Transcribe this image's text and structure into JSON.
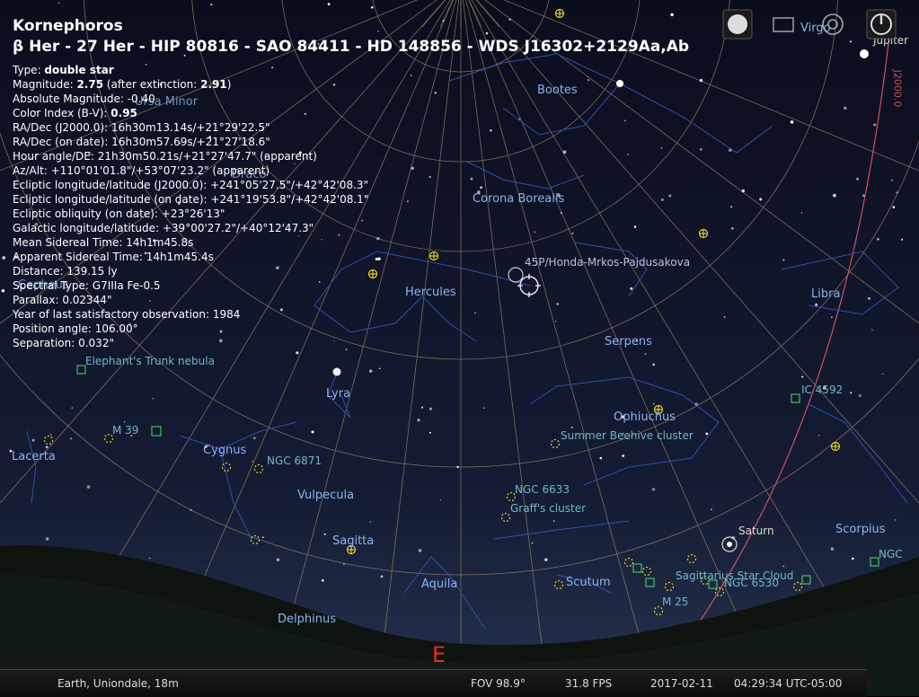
{
  "object": {
    "name": "Kornephoros",
    "designations": "β Her - 27 Her - HIP 80816 - SAO 84411 - HD 148856 - WDS J16302+2129Aa,Ab",
    "type_label": "Type: ",
    "type_value": "double star",
    "magnitude_label": "Magnitude: ",
    "magnitude_value": "2.75",
    "magnitude_extinction_label": " (after extinction: ",
    "magnitude_extinction_value": "2.91",
    "magnitude_close": ")",
    "absolute_magnitude": "Absolute Magnitude: -0.40",
    "color_index_label": "Color Index (B-V): ",
    "color_index_value": "0.95",
    "radec_j2000": "RA/Dec (J2000.0): 16h30m13.14s/+21°29'22.5\"",
    "radec_date": "RA/Dec (on date): 16h30m57.69s/+21°27'18.6\"",
    "hour_angle": "Hour angle/DE: 21h30m50.21s/+21°27'47.7\" (apparent)",
    "az_alt": "Az/Alt: +110°01'01.8\"/+53°07'23.2\" (apparent)",
    "ecl_j2000": "Ecliptic longitude/latitude (J2000.0): +241°05'27.5\"/+42°42'08.3\"",
    "ecl_date": "Ecliptic longitude/latitude (on date): +241°19'53.8\"/+42°42'08.1\"",
    "ecl_obliquity": "Ecliptic obliquity (on date): +23°26'13\"",
    "galactic": "Galactic longitude/latitude: +39°00'27.2\"/+40°12'47.3\"",
    "mean_sidereal": "Mean Sidereal Time: 14h1m45.8s",
    "apparent_sidereal": "Apparent Sidereal Time: 14h1m45.4s",
    "distance": "Distance: 139.15 ly",
    "spectral": "Spectral Type: G7IIIa Fe-0.5",
    "parallax": "Parallax: 0.02344\"",
    "last_observation": "Year of last satisfactory observation: 1984",
    "position_angle": "Position angle: 106.00°",
    "separation": "Separation: 0.032\""
  },
  "sky_labels": {
    "bootes": "Bootes",
    "corona_borealis": "Corona Borealis",
    "hercules": "Hercules",
    "serpens": "Serpens",
    "libra": "Libra",
    "lyra": "Lyra",
    "ophiuchus": "Ophiuchus",
    "cygnus": "Cygnus",
    "lacerta": "Lacerta",
    "vulpecula": "Vulpecula",
    "sagitta": "Sagitta",
    "aquila": "Aquila",
    "delphinus": "Delphinus",
    "scutum": "Scutum",
    "scorpius": "Scorpius",
    "ursa_minor": "Ursa Minor",
    "cepheus": "Cepheus",
    "draco": "Draco",
    "virgo": "Virgo",
    "jupiter": "Jupiter",
    "saturn": "Saturn",
    "comet": "45P/Honda-Mrkos-Pajdusakova",
    "elephant_trunk": "Elephant's Trunk nebula",
    "m39": "M 39",
    "ngc6871": "NGC 6871",
    "summer_beehive": "Summer Beehive cluster",
    "ngc6633": "NGC 6633",
    "graffs": "Graff's cluster",
    "ic4592": "IC 4592",
    "sgr_star_cloud": "Sagittarius Star Cloud",
    "ngc6530": "NGC 6530",
    "m25": "M 25",
    "ngc_edge": "NGC",
    "j2000": "J2000.0",
    "cardinal_east": "E"
  },
  "status": {
    "location": "Earth, Uniondale, 18m",
    "fov": "FOV 98.9°",
    "fps": "31.8 FPS",
    "date": "2017-02-11",
    "time": "04:29:34 UTC-05:00"
  },
  "colors": {
    "sky_top": "#0a0d1c",
    "sky_bottom": "#1e2a48",
    "grid": "#a08a6a",
    "constellation_line": "#2f4fb0",
    "label": "#8ab4f0",
    "nebula": "#6fb8c8",
    "ecliptic": "#d05060",
    "cardinal": "#e03020"
  }
}
